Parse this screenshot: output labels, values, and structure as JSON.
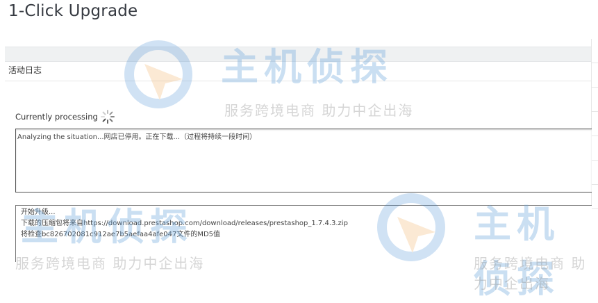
{
  "page": {
    "title": "1-Click Upgrade"
  },
  "panel": {
    "heading": "活动日志"
  },
  "processing": {
    "label": "Currently processing"
  },
  "log1": {
    "text": "Analyzing the situation...网店已停用。正在下载...（过程将持续一段时间）"
  },
  "log2": {
    "lines": [
      "开始升级...",
      "下载的压缩包将来自https://download.prestashop.com/download/releases/prestashop_1.7.4.3.zip",
      "将检查bc826702081c912ae7b5aefaa4afe047文件的MD5值"
    ]
  },
  "watermark": {
    "brand": "主机侦探",
    "slogan": "服务跨境电商 助力中企出海"
  },
  "colors": {
    "watermark_blue": "#6aa6dc",
    "watermark_orange": "#f0a040"
  }
}
